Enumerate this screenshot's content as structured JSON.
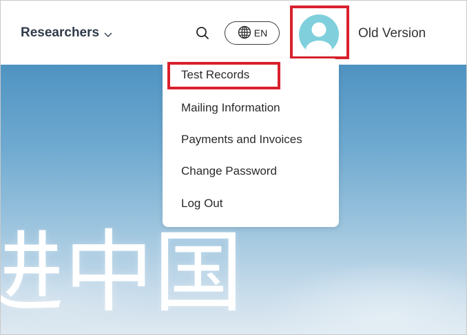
{
  "header": {
    "nav_label": "Researchers",
    "language_label": "EN",
    "old_version_label": "Old Version"
  },
  "icons": {
    "nav_chevron": "chevron-down-icon",
    "search": "search-icon",
    "language": "globe-icon",
    "avatar": "user-avatar-icon"
  },
  "colors": {
    "highlight": "#d9202d",
    "avatar": "#7fd0dc"
  },
  "user_menu": {
    "items": [
      {
        "label": "Test Records"
      },
      {
        "label": "Mailing Information"
      },
      {
        "label": "Payments and Invoices"
      },
      {
        "label": "Change Password"
      },
      {
        "label": "Log Out"
      }
    ]
  },
  "hero": {
    "text": "进中国"
  }
}
